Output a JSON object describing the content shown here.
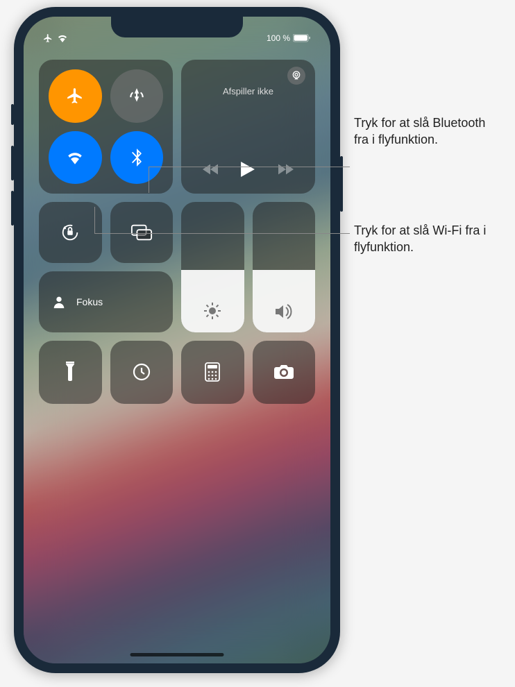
{
  "status_bar": {
    "battery_text": "100 %"
  },
  "connectivity": {
    "airplane": {
      "on": true
    },
    "cellular": {
      "on": false
    },
    "wifi": {
      "on": true
    },
    "bluetooth": {
      "on": true
    }
  },
  "media": {
    "title": "Afspiller ikke"
  },
  "focus": {
    "label": "Fokus"
  },
  "sliders": {
    "brightness_pct": 48,
    "volume_pct": 48
  },
  "callouts": {
    "bluetooth": "Tryk for at slå Bluetooth fra i flyfunktion.",
    "wifi": "Tryk for at slå Wi-Fi fra i flyfunktion."
  },
  "icons": {
    "airplane": "airplane-icon",
    "cellular": "cellular-antenna-icon",
    "wifi": "wifi-icon",
    "bluetooth": "bluetooth-icon",
    "airplay": "airplay-icon",
    "prev": "previous-track-icon",
    "play": "play-icon",
    "next": "next-track-icon",
    "rotation_lock": "rotation-lock-icon",
    "screen_mirror": "screen-mirror-icon",
    "person": "person-icon",
    "brightness": "brightness-icon",
    "volume": "volume-icon",
    "flashlight": "flashlight-icon",
    "timer": "timer-icon",
    "calculator": "calculator-icon",
    "camera": "camera-icon"
  }
}
